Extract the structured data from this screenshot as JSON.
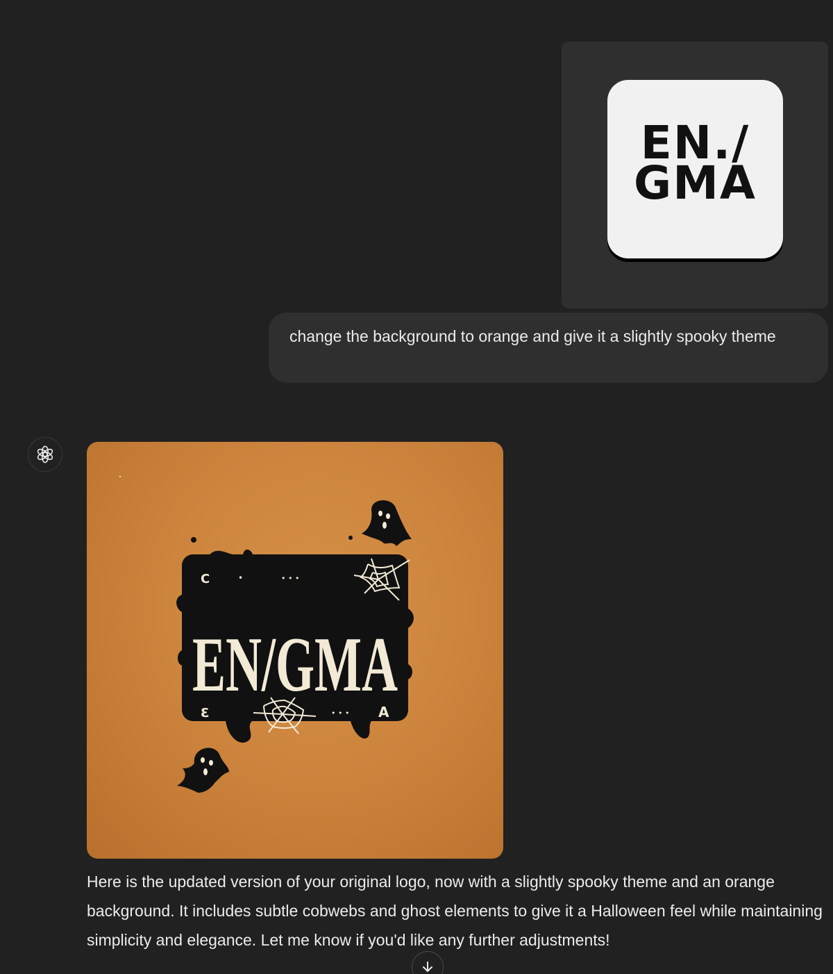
{
  "user_message": {
    "image_alt": "Uploaded logo image",
    "logo_text": "EN./\nGMA",
    "text": "change the background to orange and give it a slightly spooky theme"
  },
  "assistant_message": {
    "avatar_icon": "chatgpt-logo-icon",
    "generated_image": {
      "main_text": "EN/GMA",
      "corner_top_left": "C",
      "corner_bottom_left": "Ɛ",
      "corner_bottom_right": "A",
      "dots_top": "• • •",
      "dots_bottom": "• • •",
      "dot_single": "•",
      "background_color": "#cd853e",
      "badge_color": "#111111",
      "text_color": "#f3ead6"
    },
    "text": "Here is the updated version of your original logo, now with a slightly spooky theme and an orange background. It includes subtle cobwebs and ghost elements to give it a Halloween feel while maintaining simplicity and elegance. Let me know if you'd like any further adjustments!"
  },
  "scroll_button": {
    "icon": "arrow-down-icon"
  }
}
